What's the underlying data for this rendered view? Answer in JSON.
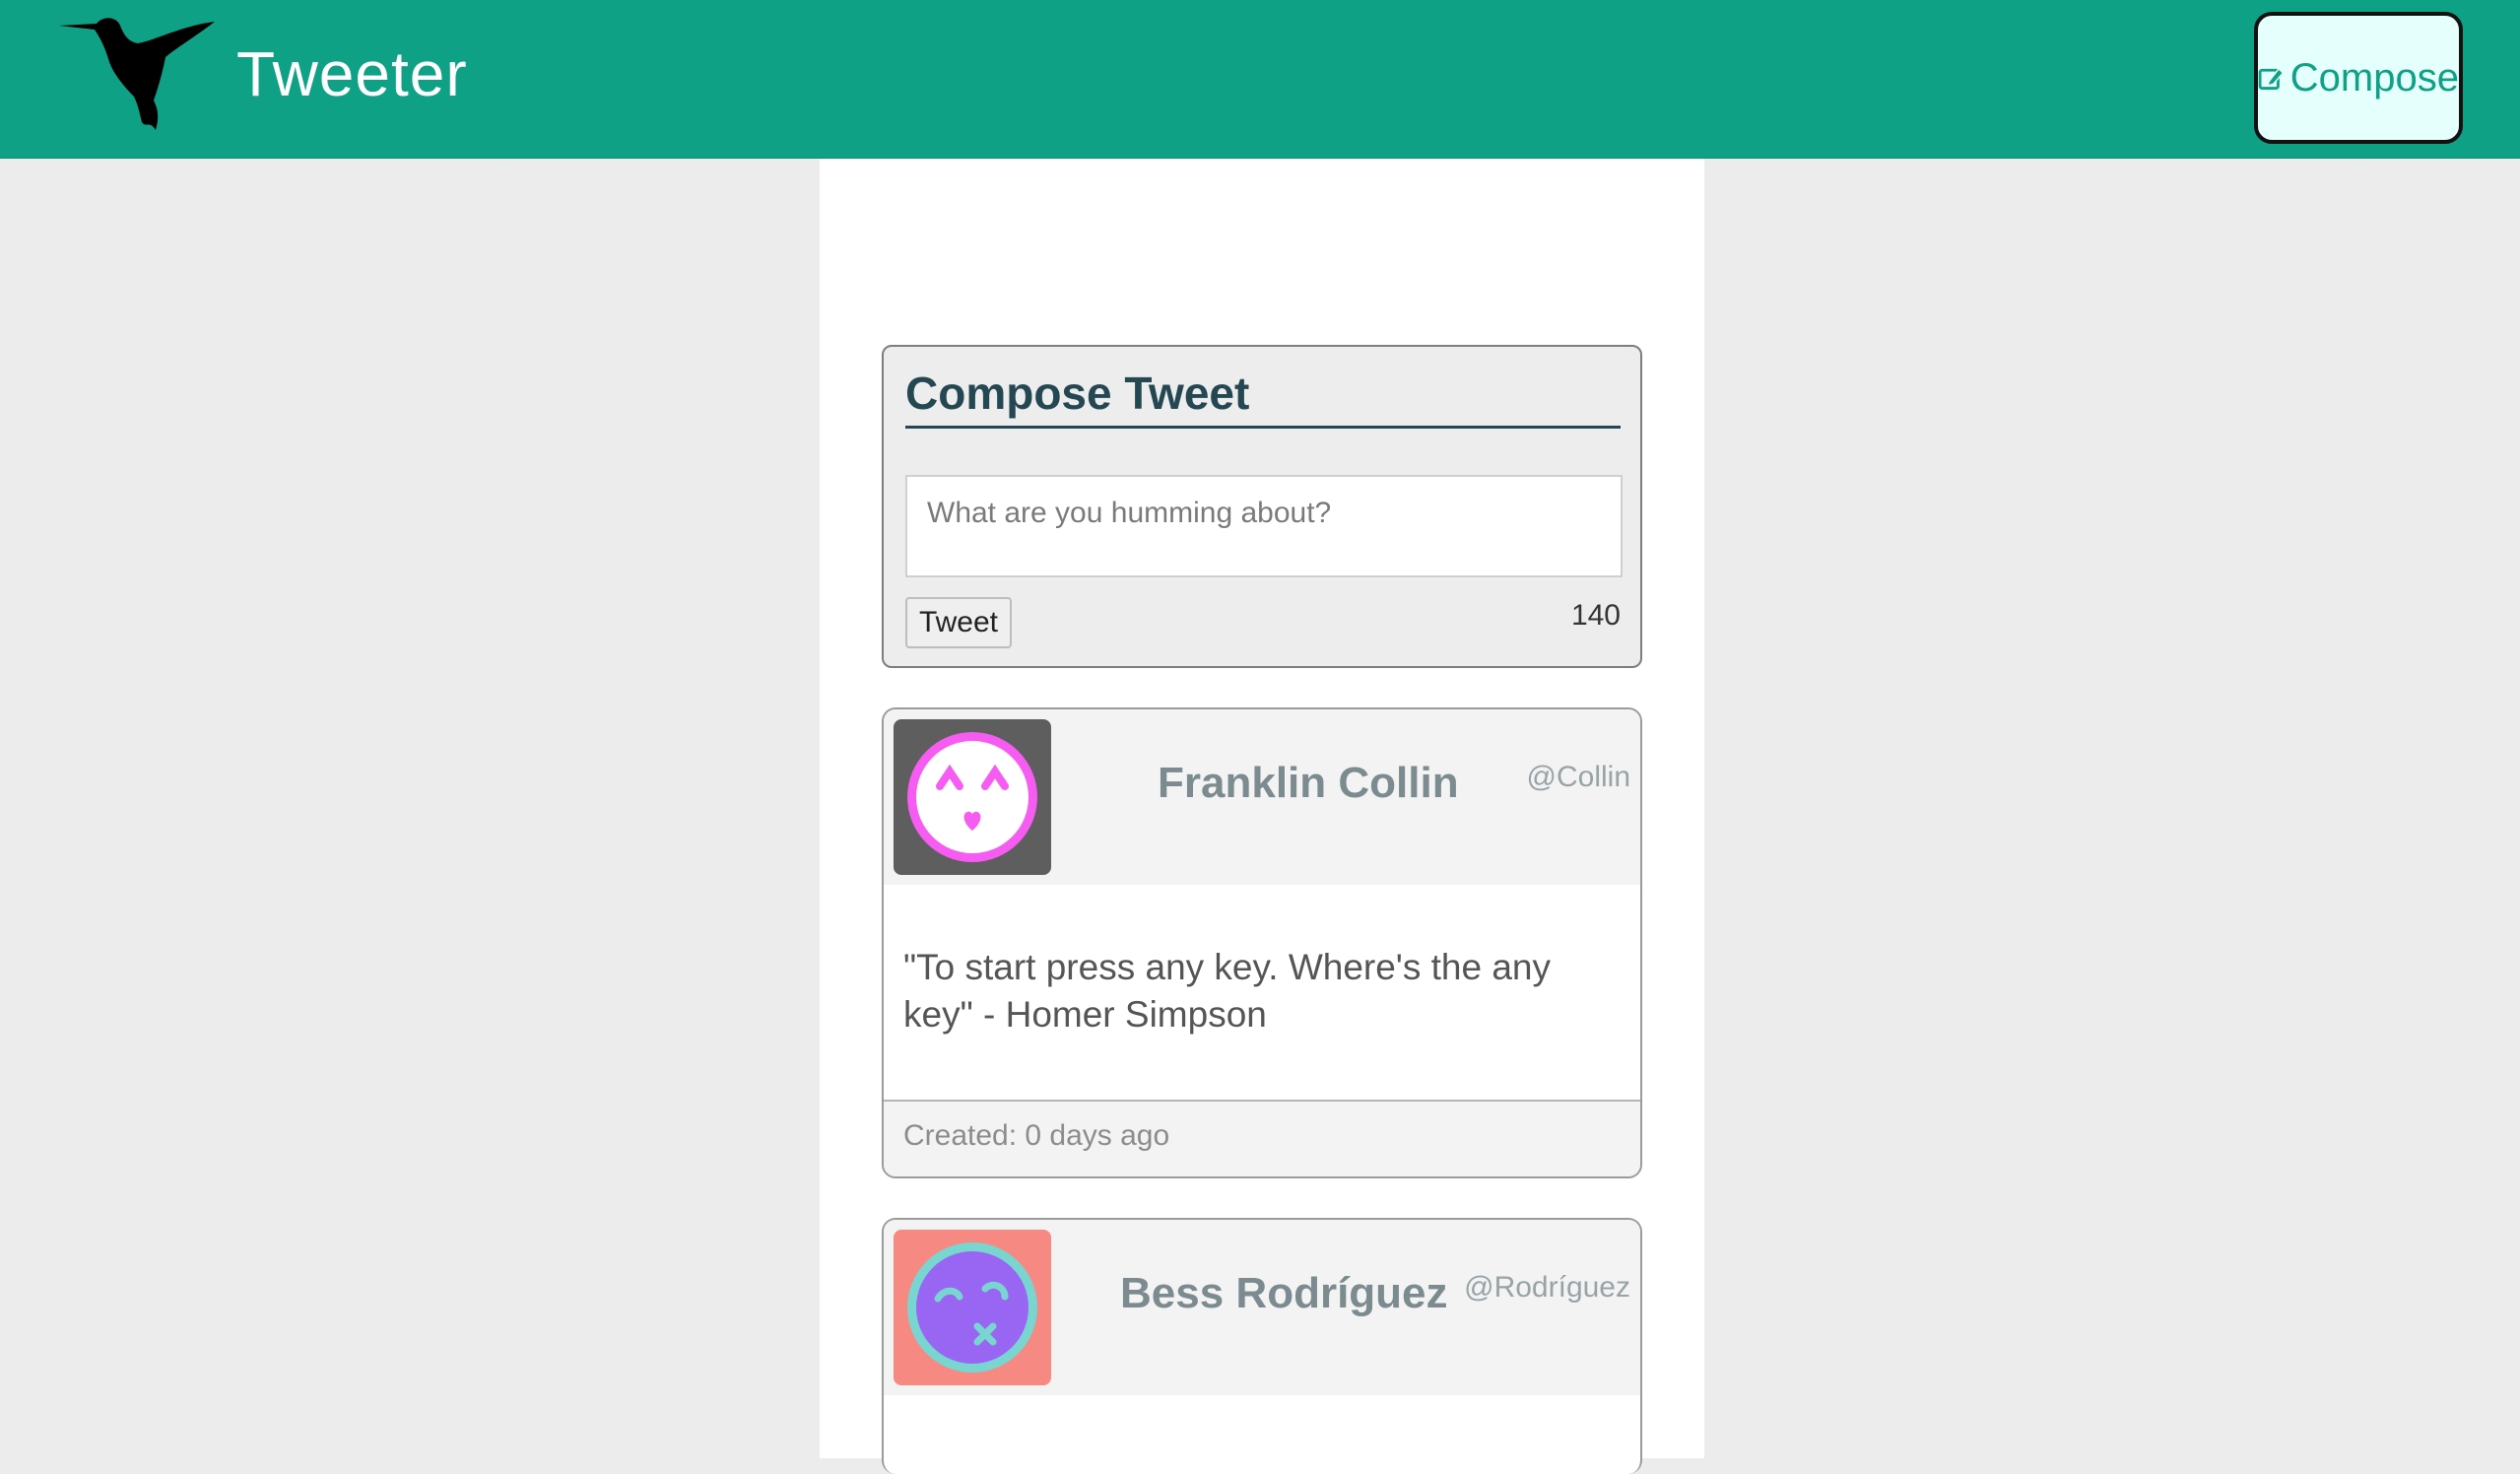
{
  "nav": {
    "title": "Tweeter",
    "logo_icon": "hummingbird-icon",
    "compose_icon": "edit-icon",
    "compose_label": "Compose",
    "accent_color": "#0fa186"
  },
  "compose": {
    "title": "Compose Tweet",
    "placeholder": "What are you humming about?",
    "value": "",
    "button_label": "Tweet",
    "counter": "140"
  },
  "tweets": [
    {
      "name": "Franklin Collin",
      "handle": "@Collin",
      "text": "\"To start press any key. Where's the any key\" - Homer Simpson",
      "created": "Created: 0 days ago",
      "avatar_bg": "#5e5e5e",
      "avatar_color": "#f75cf2"
    },
    {
      "name": "Bess Rodríguez",
      "handle": "@Rodríguez",
      "avatar_bg": "#f68a82",
      "avatar_color": "#9966f4"
    }
  ]
}
